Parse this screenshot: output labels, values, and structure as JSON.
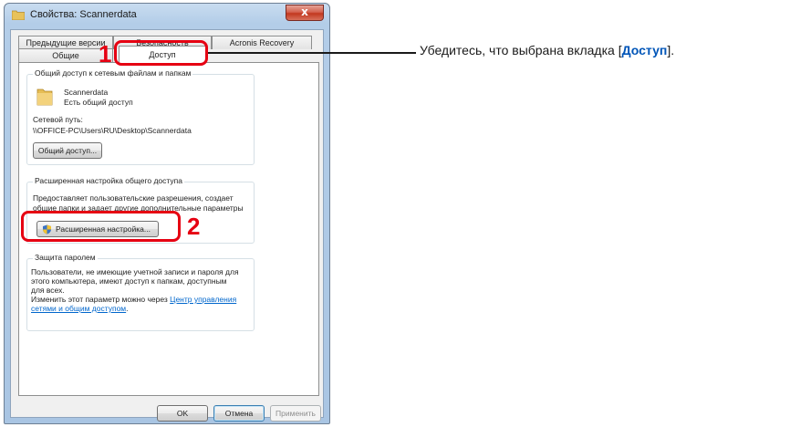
{
  "window": {
    "title": "Свойства: Scannerdata",
    "close_label": "x"
  },
  "tabs": {
    "row_back": [
      "Предыдущие версии",
      "Безопасность",
      "Acronis Recovery"
    ],
    "row_front": [
      "Общие",
      "Доступ"
    ],
    "active": "Доступ"
  },
  "sharing": {
    "group_title": "Общий доступ к сетевым файлам и папкам",
    "folder_name": "Scannerdata",
    "folder_status": "Есть общий доступ",
    "network_path_label": "Сетевой путь:",
    "network_path": "\\\\OFFICE-PC\\Users\\RU\\Desktop\\Scannerdata",
    "share_button": "Общий доступ..."
  },
  "advanced": {
    "group_title": "Расширенная настройка общего доступа",
    "description_line1": "Предоставляет пользовательские разрешения, создает",
    "description_line2": "общие папки и задает другие дополнительные параметры",
    "button": "Расширенная настройка..."
  },
  "password": {
    "group_title": "Защита паролем",
    "line1": "Пользователи, не имеющие учетной записи и пароля для",
    "line2": "этого компьютера, имеют доступ к папкам, доступным",
    "line3": "для всех.",
    "line4": "Изменить этот параметр можно через",
    "link_part1": "Центр управления",
    "link_part2": "сетями и общим доступом",
    "period": "."
  },
  "footer": {
    "ok": "OK",
    "cancel": "Отмена",
    "apply": "Применить"
  },
  "annotations": {
    "step1": "1",
    "step2": "2",
    "instruction_prefix": "Убедитесь, что выбрана вкладка [",
    "instruction_bold": "Доступ",
    "instruction_suffix": "].",
    "highlight_color": "#e60012",
    "bold_color": "#0055b8"
  }
}
